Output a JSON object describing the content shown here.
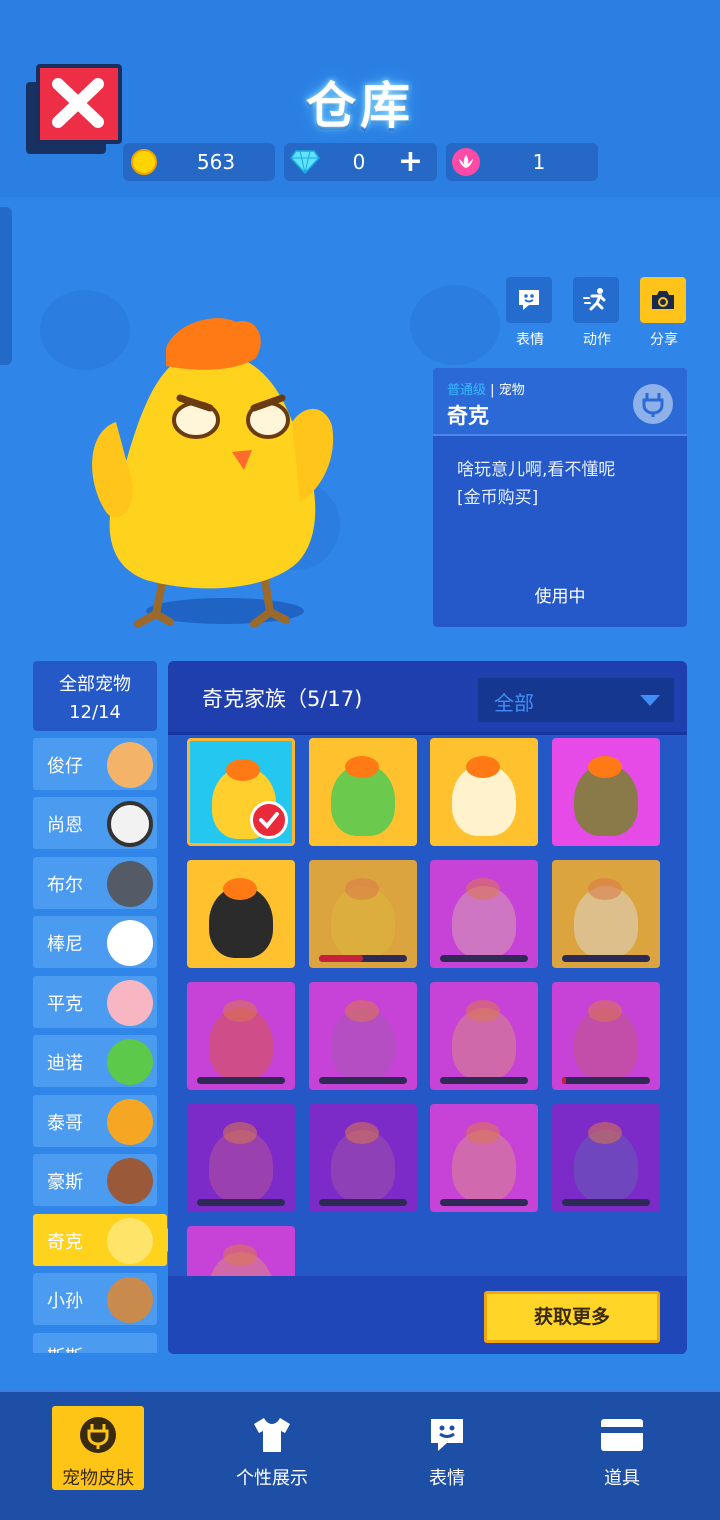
{
  "header": {
    "title": "仓库",
    "currencies": [
      {
        "icon": "gold-coin-icon",
        "value": "563"
      },
      {
        "icon": "diamond-icon",
        "value": "0",
        "add": "+"
      },
      {
        "icon": "lotus-flower-icon",
        "value": "1"
      }
    ]
  },
  "actions": [
    {
      "label": "表情",
      "icon": "emote-icon"
    },
    {
      "label": "动作",
      "icon": "action-runner-icon"
    },
    {
      "label": "分享",
      "icon": "camera-icon"
    }
  ],
  "pet_info": {
    "grade": "普通级",
    "separator": "|",
    "type": "宠物",
    "name": "奇克",
    "description_line1": "啥玩意儿啊,看不懂呢",
    "description_line2": "[金币购买]",
    "status": "使用中"
  },
  "categories": {
    "all_label": "全部宠物",
    "all_count": "12/14",
    "items": [
      {
        "label": "俊仔",
        "color": "#f3b46a"
      },
      {
        "label": "尚恩",
        "color": "#f2f2f2"
      },
      {
        "label": "布尔",
        "color": "#555b66"
      },
      {
        "label": "棒尼",
        "color": "#ffffff"
      },
      {
        "label": "平克",
        "color": "#f7b6c2"
      },
      {
        "label": "迪诺",
        "color": "#5cc94a"
      },
      {
        "label": "泰哥",
        "color": "#f5a623"
      },
      {
        "label": "豪斯",
        "color": "#9a5a3a"
      },
      {
        "label": "奇克",
        "color": "#ffd21e"
      },
      {
        "label": "小孙",
        "color": "#c98a4e"
      }
    ],
    "partial_label": "斯斯",
    "active": "奇克"
  },
  "skins_panel": {
    "family_title": "奇克家族（5/17)",
    "filter": "全部",
    "get_more": "获取更多",
    "skins": [
      {
        "bg": "#24c7f0",
        "body": "#ffcf2e",
        "state": "selected"
      },
      {
        "bg": "#ffc22e",
        "body": "#6bc94d",
        "state": "owned"
      },
      {
        "bg": "#ffc22e",
        "body": "#fff2cc",
        "state": "owned"
      },
      {
        "bg": "#e64be8",
        "body": "#8a7a4a",
        "state": "owned"
      },
      {
        "bg": "#ffc22e",
        "body": "#2b2b2b",
        "state": "owned"
      },
      {
        "bg": "#ffc22e",
        "body": "#ffcf2e",
        "state": "locked",
        "progress": 0.5
      },
      {
        "bg": "#e64be8",
        "body": "#f08acf",
        "state": "locked",
        "progress": 0
      },
      {
        "bg": "#ffc22e",
        "body": "#ffe38a",
        "state": "locked",
        "progress": 0
      },
      {
        "bg": "#e64be8",
        "body": "#f05a8a",
        "state": "locked",
        "progress": 0
      },
      {
        "bg": "#e64be8",
        "body": "#d05ad0",
        "state": "locked",
        "progress": 0
      },
      {
        "bg": "#e64be8",
        "body": "#f07ab0",
        "state": "locked",
        "progress": 0
      },
      {
        "bg": "#e64be8",
        "body": "#e05ab0",
        "state": "locked",
        "progress": 0.05
      },
      {
        "bg": "#8a2fd6",
        "body": "#b04ab8",
        "state": "locked",
        "progress": 0
      },
      {
        "bg": "#8a2fd6",
        "body": "#a04ac0",
        "state": "locked",
        "progress": 0
      },
      {
        "bg": "#e64be8",
        "body": "#f27ab8",
        "state": "locked",
        "progress": 0
      },
      {
        "bg": "#8a2fd6",
        "body": "#7a50c8",
        "state": "locked",
        "progress": 0
      },
      {
        "bg": "#e64be8",
        "body": "#f07ab0",
        "state": "locked",
        "progress": 0
      }
    ]
  },
  "bottom_nav": [
    {
      "label": "宠物皮肤",
      "icon": "pet-plug-icon",
      "active": true
    },
    {
      "label": "个性展示",
      "icon": "tshirt-icon",
      "active": false
    },
    {
      "label": "表情",
      "icon": "emote-icon",
      "active": false
    },
    {
      "label": "道具",
      "icon": "card-icon",
      "active": false
    }
  ]
}
